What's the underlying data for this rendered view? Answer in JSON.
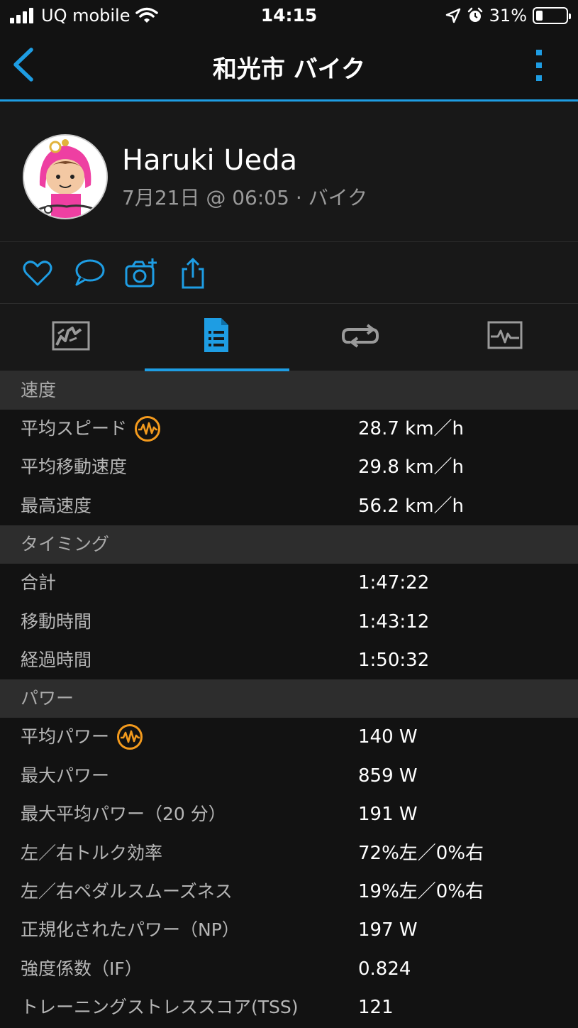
{
  "status_bar": {
    "carrier": "UQ mobile",
    "time": "14:15",
    "battery": "31%"
  },
  "nav": {
    "title": "和光市 バイク"
  },
  "profile": {
    "name": "Haruki Ueda",
    "meta": "7月21日 @ 06:05 · バイク"
  },
  "colors": {
    "accent": "#1e9de3",
    "badge": "#f39a1d",
    "background": "#121212"
  },
  "sections": [
    {
      "title": "速度",
      "rows": [
        {
          "label": "平均スピード",
          "value": "28.7 km／h",
          "badge": true
        },
        {
          "label": "平均移動速度",
          "value": "29.8 km／h"
        },
        {
          "label": "最高速度",
          "value": "56.2 km／h"
        }
      ]
    },
    {
      "title": "タイミング",
      "rows": [
        {
          "label": "合計",
          "value": "1:47:22"
        },
        {
          "label": "移動時間",
          "value": "1:43:12"
        },
        {
          "label": "経過時間",
          "value": "1:50:32"
        }
      ]
    },
    {
      "title": "パワー",
      "rows": [
        {
          "label": "平均パワー",
          "value": "140 W",
          "badge": true
        },
        {
          "label": "最大パワー",
          "value": "859 W"
        },
        {
          "label": "最大平均パワー（20 分）",
          "value": "191 W"
        },
        {
          "label": "左／右トルク効率",
          "value": "72%左／0%右"
        },
        {
          "label": "左／右ペダルスムーズネス",
          "value": "19%左／0%右"
        },
        {
          "label": "正規化されたパワー（NP）",
          "value": "197 W"
        },
        {
          "label": "強度係数（IF）",
          "value": "0.824"
        },
        {
          "label": "トレーニングストレススコア(TSS)",
          "value": "121"
        }
      ]
    }
  ]
}
